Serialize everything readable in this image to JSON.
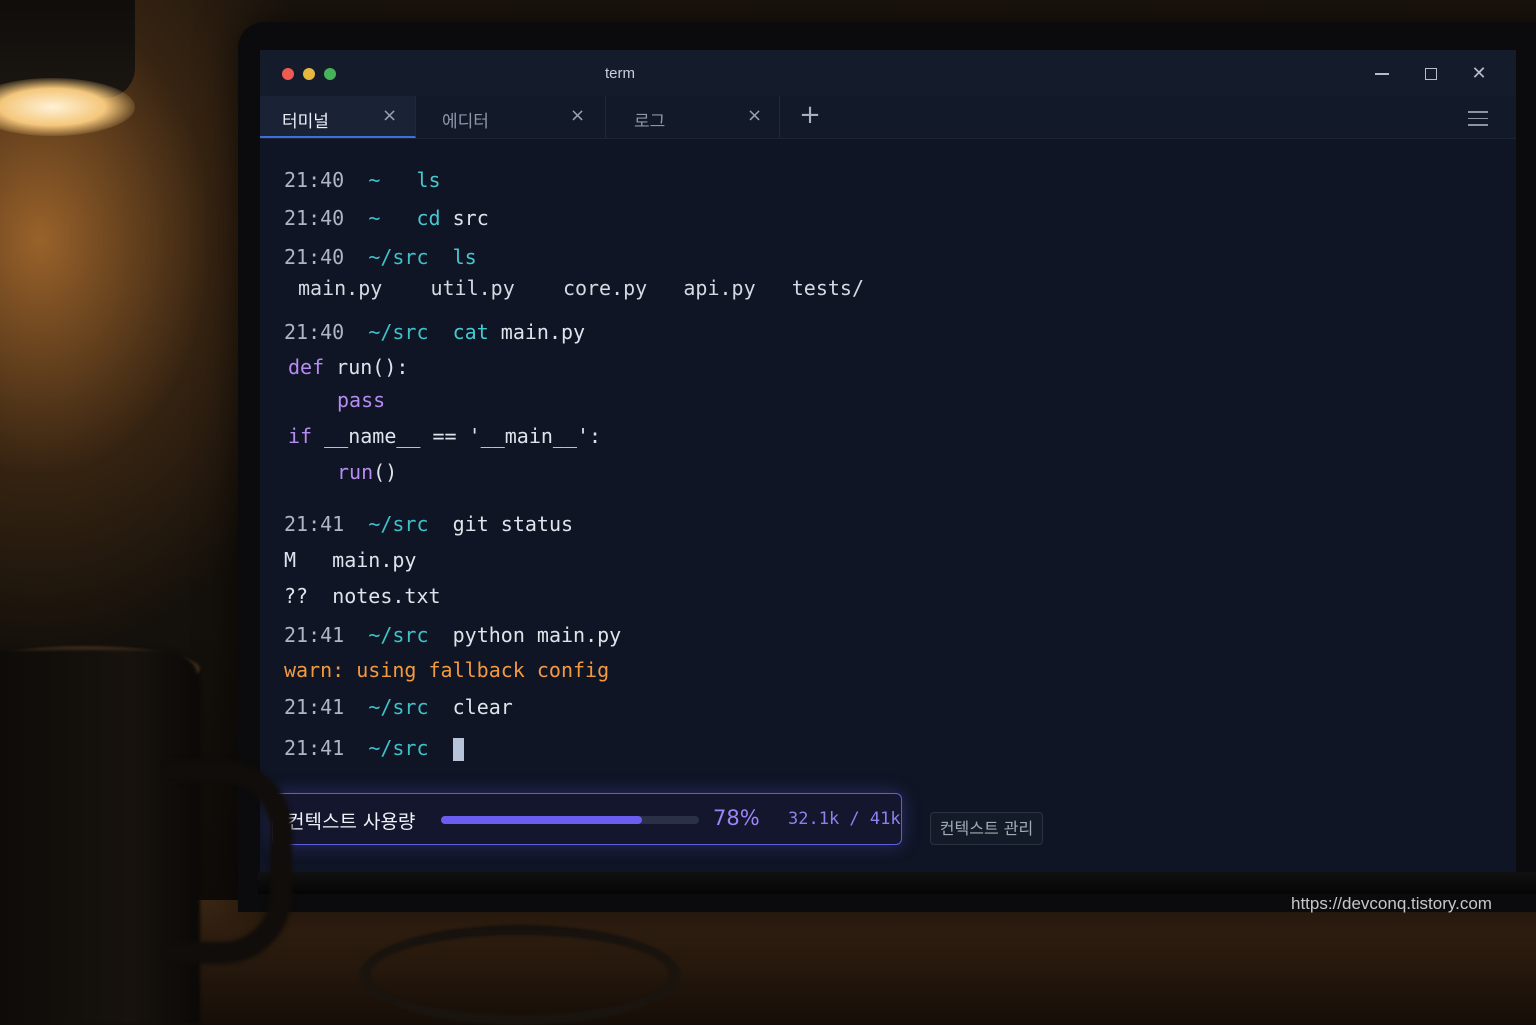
{
  "window": {
    "title": "term"
  },
  "tabs": [
    {
      "label": "터미널",
      "active": true
    },
    {
      "label": "에디터",
      "active": false
    },
    {
      "label": "로그",
      "active": false
    }
  ],
  "tab_close_glyph": "×",
  "tab_add_glyph": "+",
  "window_close_glyph": "✕",
  "terminal": {
    "lines": [
      {
        "time": "21:40",
        "path": "~",
        "cmd": "ls"
      },
      {
        "time": "21:40",
        "path": "~",
        "cmd_kw": "cd",
        "cmd": "src"
      },
      {
        "time": "21:40",
        "path": "~/src",
        "cmd": "ls"
      },
      {
        "output": [
          "main.py",
          "util.py",
          "core.py",
          "api.py",
          "tests/"
        ]
      },
      {
        "time": "21:40",
        "path": "~/src",
        "cmd_kw": "cat",
        "cmd": "main.py"
      }
    ],
    "code": {
      "l1_kw": "def",
      "l1_rest": " run():",
      "l2_kw": "pass",
      "l3_kw": "if",
      "l3_rest": " __name__ == '__main__':",
      "l4_kw": "run",
      "l4_rest": "()"
    },
    "git": {
      "time": "21:41",
      "path": "~/src",
      "cmd": "git status",
      "entries": [
        {
          "status": "M",
          "file": "main.py"
        },
        {
          "status": "??",
          "file": "notes.txt"
        }
      ]
    },
    "python": {
      "time": "21:41",
      "path": "~/src",
      "cmd": "python main.py"
    },
    "warning": "warn: using fallback config",
    "clear": {
      "time": "21:41",
      "path": "~/src",
      "cmd": "clear"
    },
    "prompt": {
      "time": "21:41",
      "path": "~/src"
    }
  },
  "context": {
    "label": "컨텍스트 사용량",
    "percent_text": "78%",
    "usage_fraction": 0.78,
    "count": "32.1k / 41k",
    "manage_button": "컨텍스트 관리"
  },
  "watermark": "https://devconq.tistory.com",
  "colors": {
    "accent": "#6c5cf0",
    "path": "#3fc1c9",
    "keyword": "#b68cf2",
    "warning": "#f29a3f"
  }
}
